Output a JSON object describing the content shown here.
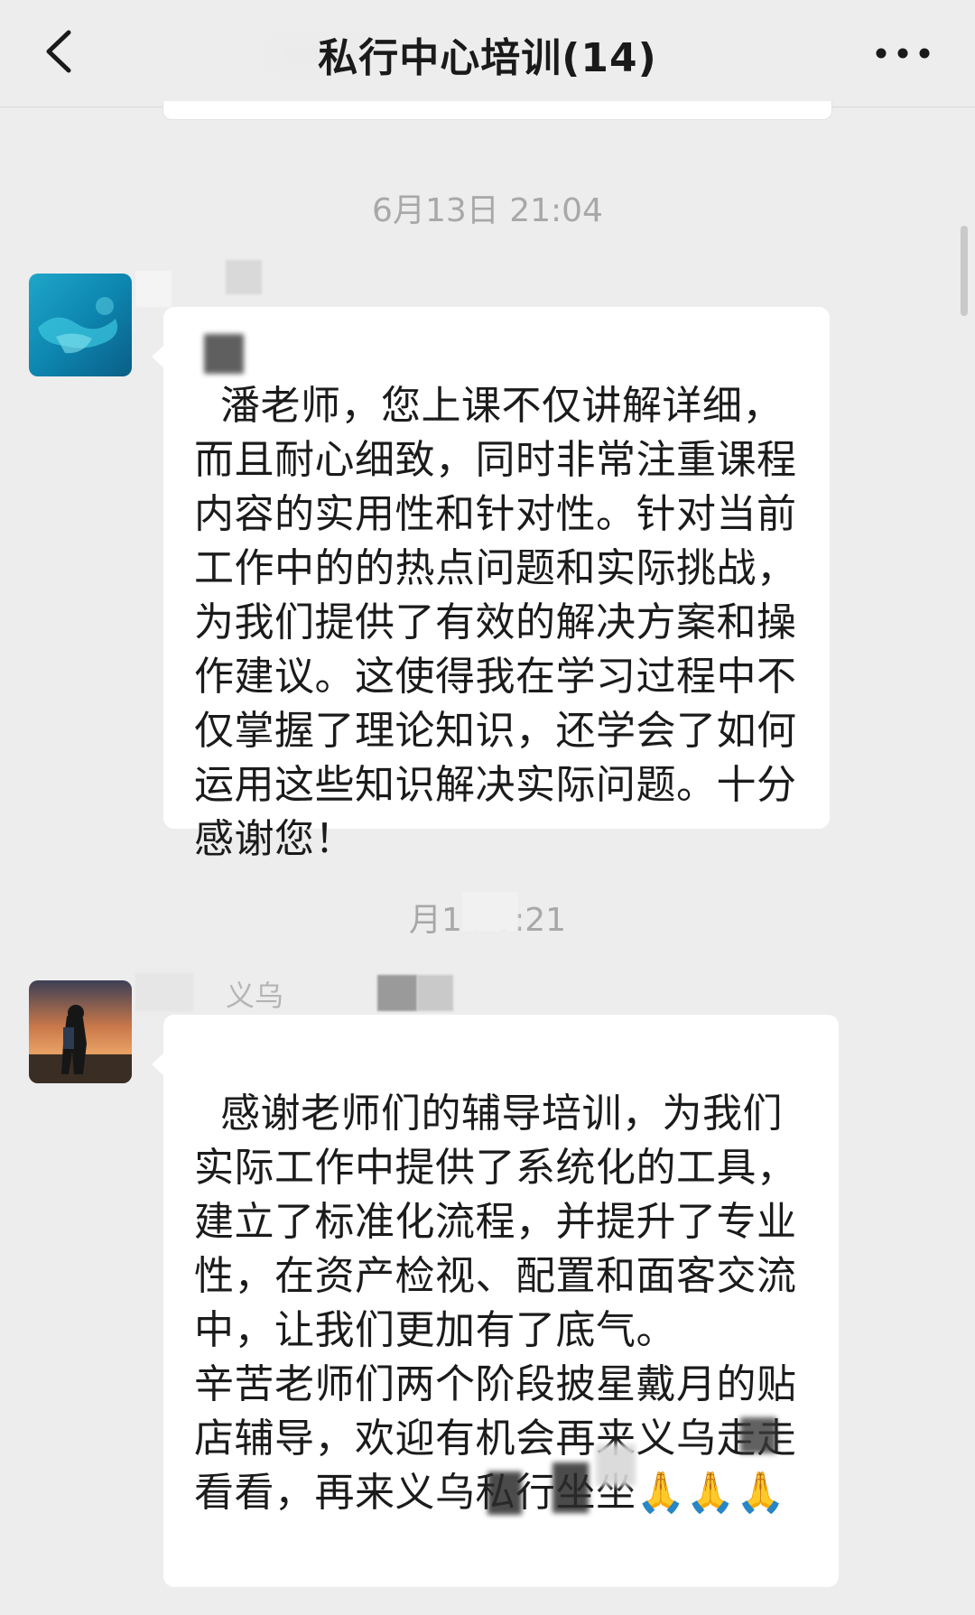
{
  "header": {
    "back_icon": "chevron-left-icon",
    "title": "私行中心培训(14)",
    "more_icon": "more-dots-icon"
  },
  "messages": [
    {
      "timestamp": "6月13日 21:04",
      "avatar": "ocean-reef-avatar",
      "text": "潘老师，您上课不仅讲解详细，而且耐心细致，同时非常注重课程内容的实用性和针对性。针对当前工作中的的热点问题和实际挑战，为我们提供了有效的解决方案和操作建议。这使得我在学习过程中不仅掌握了理论知识，还学会了如何运用这些知识解决实际问题。十分感谢您！"
    },
    {
      "timestamp": "月14  0:21",
      "avatar": "hiker-sunset-avatar",
      "sender_name": "义乌",
      "text": "感谢老师们的辅导培训，为我们实际工作中提供了系统化的工具，建立了标准化流程，并提升了专业性，在资产检视、配置和面客交流中，让我们更加有了底气。\n辛苦老师们两个阶段披星戴月的贴店辅导，欢迎有机会再来义乌走走看看，再来义乌私行坐坐🙏🙏🙏"
    }
  ],
  "colors": {
    "background": "#ededed",
    "bubble": "#ffffff",
    "timestamp": "#a8a8a8",
    "text": "#1b1b1b"
  }
}
